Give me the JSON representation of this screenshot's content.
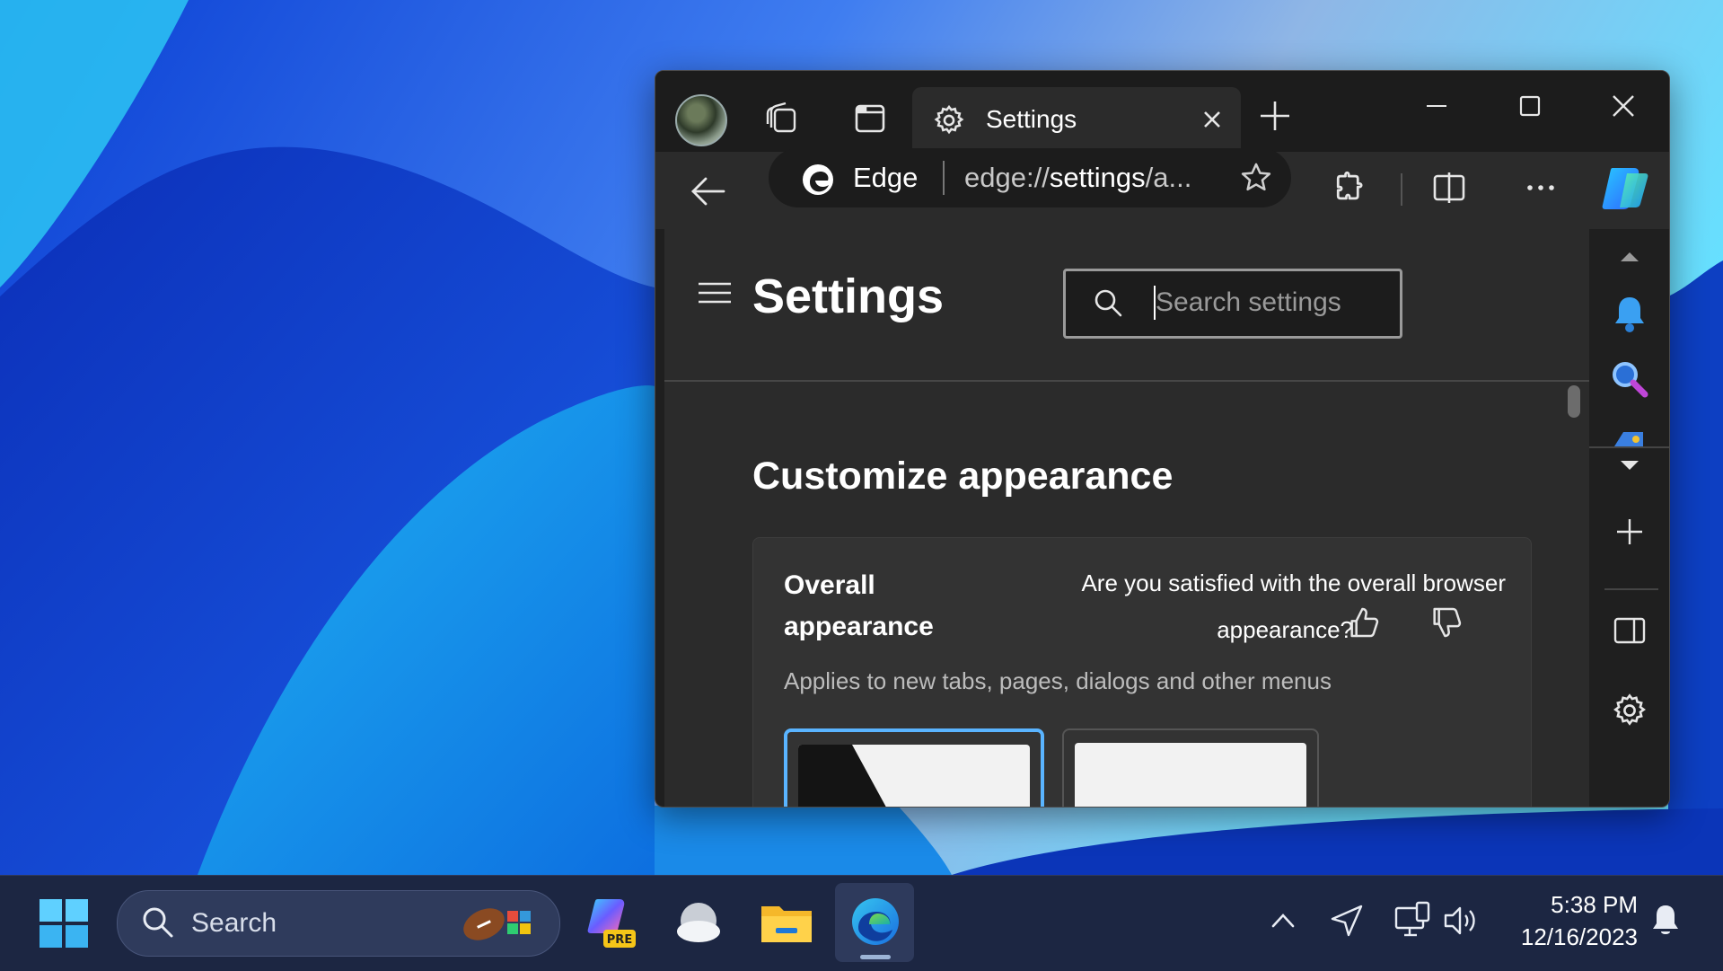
{
  "window": {
    "tab_title": "Settings",
    "tab_icons": [
      "profile-avatar",
      "workspaces-icon",
      "tab-actions-icon"
    ],
    "controls": [
      "minimize-icon",
      "maximize-icon",
      "close-icon"
    ]
  },
  "toolbar": {
    "site_label": "Edge",
    "url_prefix": "edge://",
    "url_domain": "settings",
    "url_suffix": "/a...",
    "icons": [
      "back-icon",
      "favorite-star-icon",
      "extensions-icon",
      "split-screen-icon",
      "more-icon",
      "copilot-icon"
    ]
  },
  "settings": {
    "page_title": "Settings",
    "search_placeholder": "Search settings",
    "section_title": "Customize appearance",
    "card": {
      "label": "Overall appearance",
      "feedback_question": "Are you satisfied with the overall browser appearance?",
      "description": "Applies to new tabs, pages, dialogs and other menus",
      "options": [
        "system-default-theme",
        "light-theme"
      ]
    }
  },
  "sidebar": {
    "icons": [
      "scroll-up-icon",
      "notification-icon",
      "search-icon",
      "tools-icon",
      "scroll-down-icon",
      "add-icon",
      "hide-sidebar-icon",
      "settings-icon"
    ]
  },
  "taskbar": {
    "search_placeholder": "Search",
    "pre_badge": "PRE",
    "apps": [
      "start-icon",
      "copilot-pre-icon",
      "weather-icon",
      "file-explorer-icon",
      "edge-icon"
    ],
    "tray": [
      "show-hidden-icon",
      "location-icon",
      "network-icon",
      "volume-icon"
    ],
    "time": "5:38 PM",
    "date": "12/16/2023"
  },
  "colors": {
    "accent": "#5ab4ff",
    "window_bg": "#2b2b2b",
    "taskbar_bg": "#1c2642"
  }
}
